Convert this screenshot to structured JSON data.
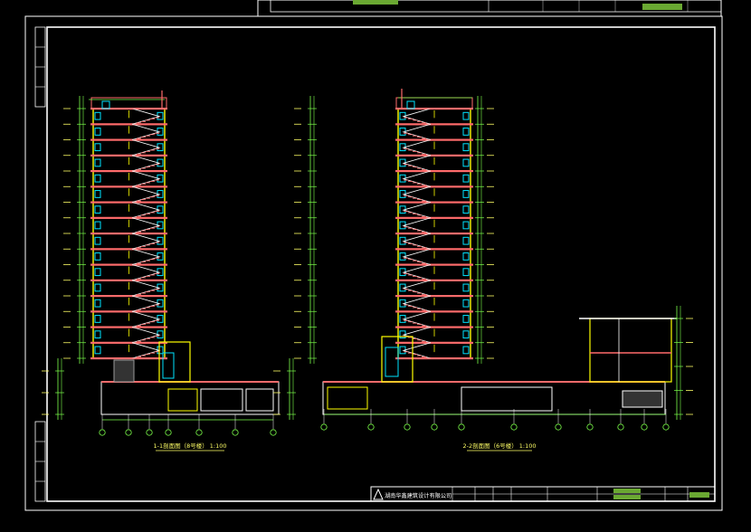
{
  "drawing": {
    "captions": {
      "left": "1-1剖面图（8号楼） 1:100",
      "right": "2-2剖面图（6号楼） 1:100"
    },
    "title_block": {
      "company": "湖南华鑫建筑设计有限公司"
    },
    "colors": {
      "frame": "#ffffff",
      "slab": "#ff6b6b",
      "wall": "#ffff00",
      "window": "#00e5ff",
      "dimension": "#7cff4a",
      "text_yellow": "#ffff66",
      "grid_bubble": "#ffffff",
      "title_fill": "#6aa832"
    },
    "section_left": {
      "floors": 16,
      "grid_axes": 7
    },
    "section_right": {
      "floors": 16,
      "grid_axes": 11
    }
  }
}
